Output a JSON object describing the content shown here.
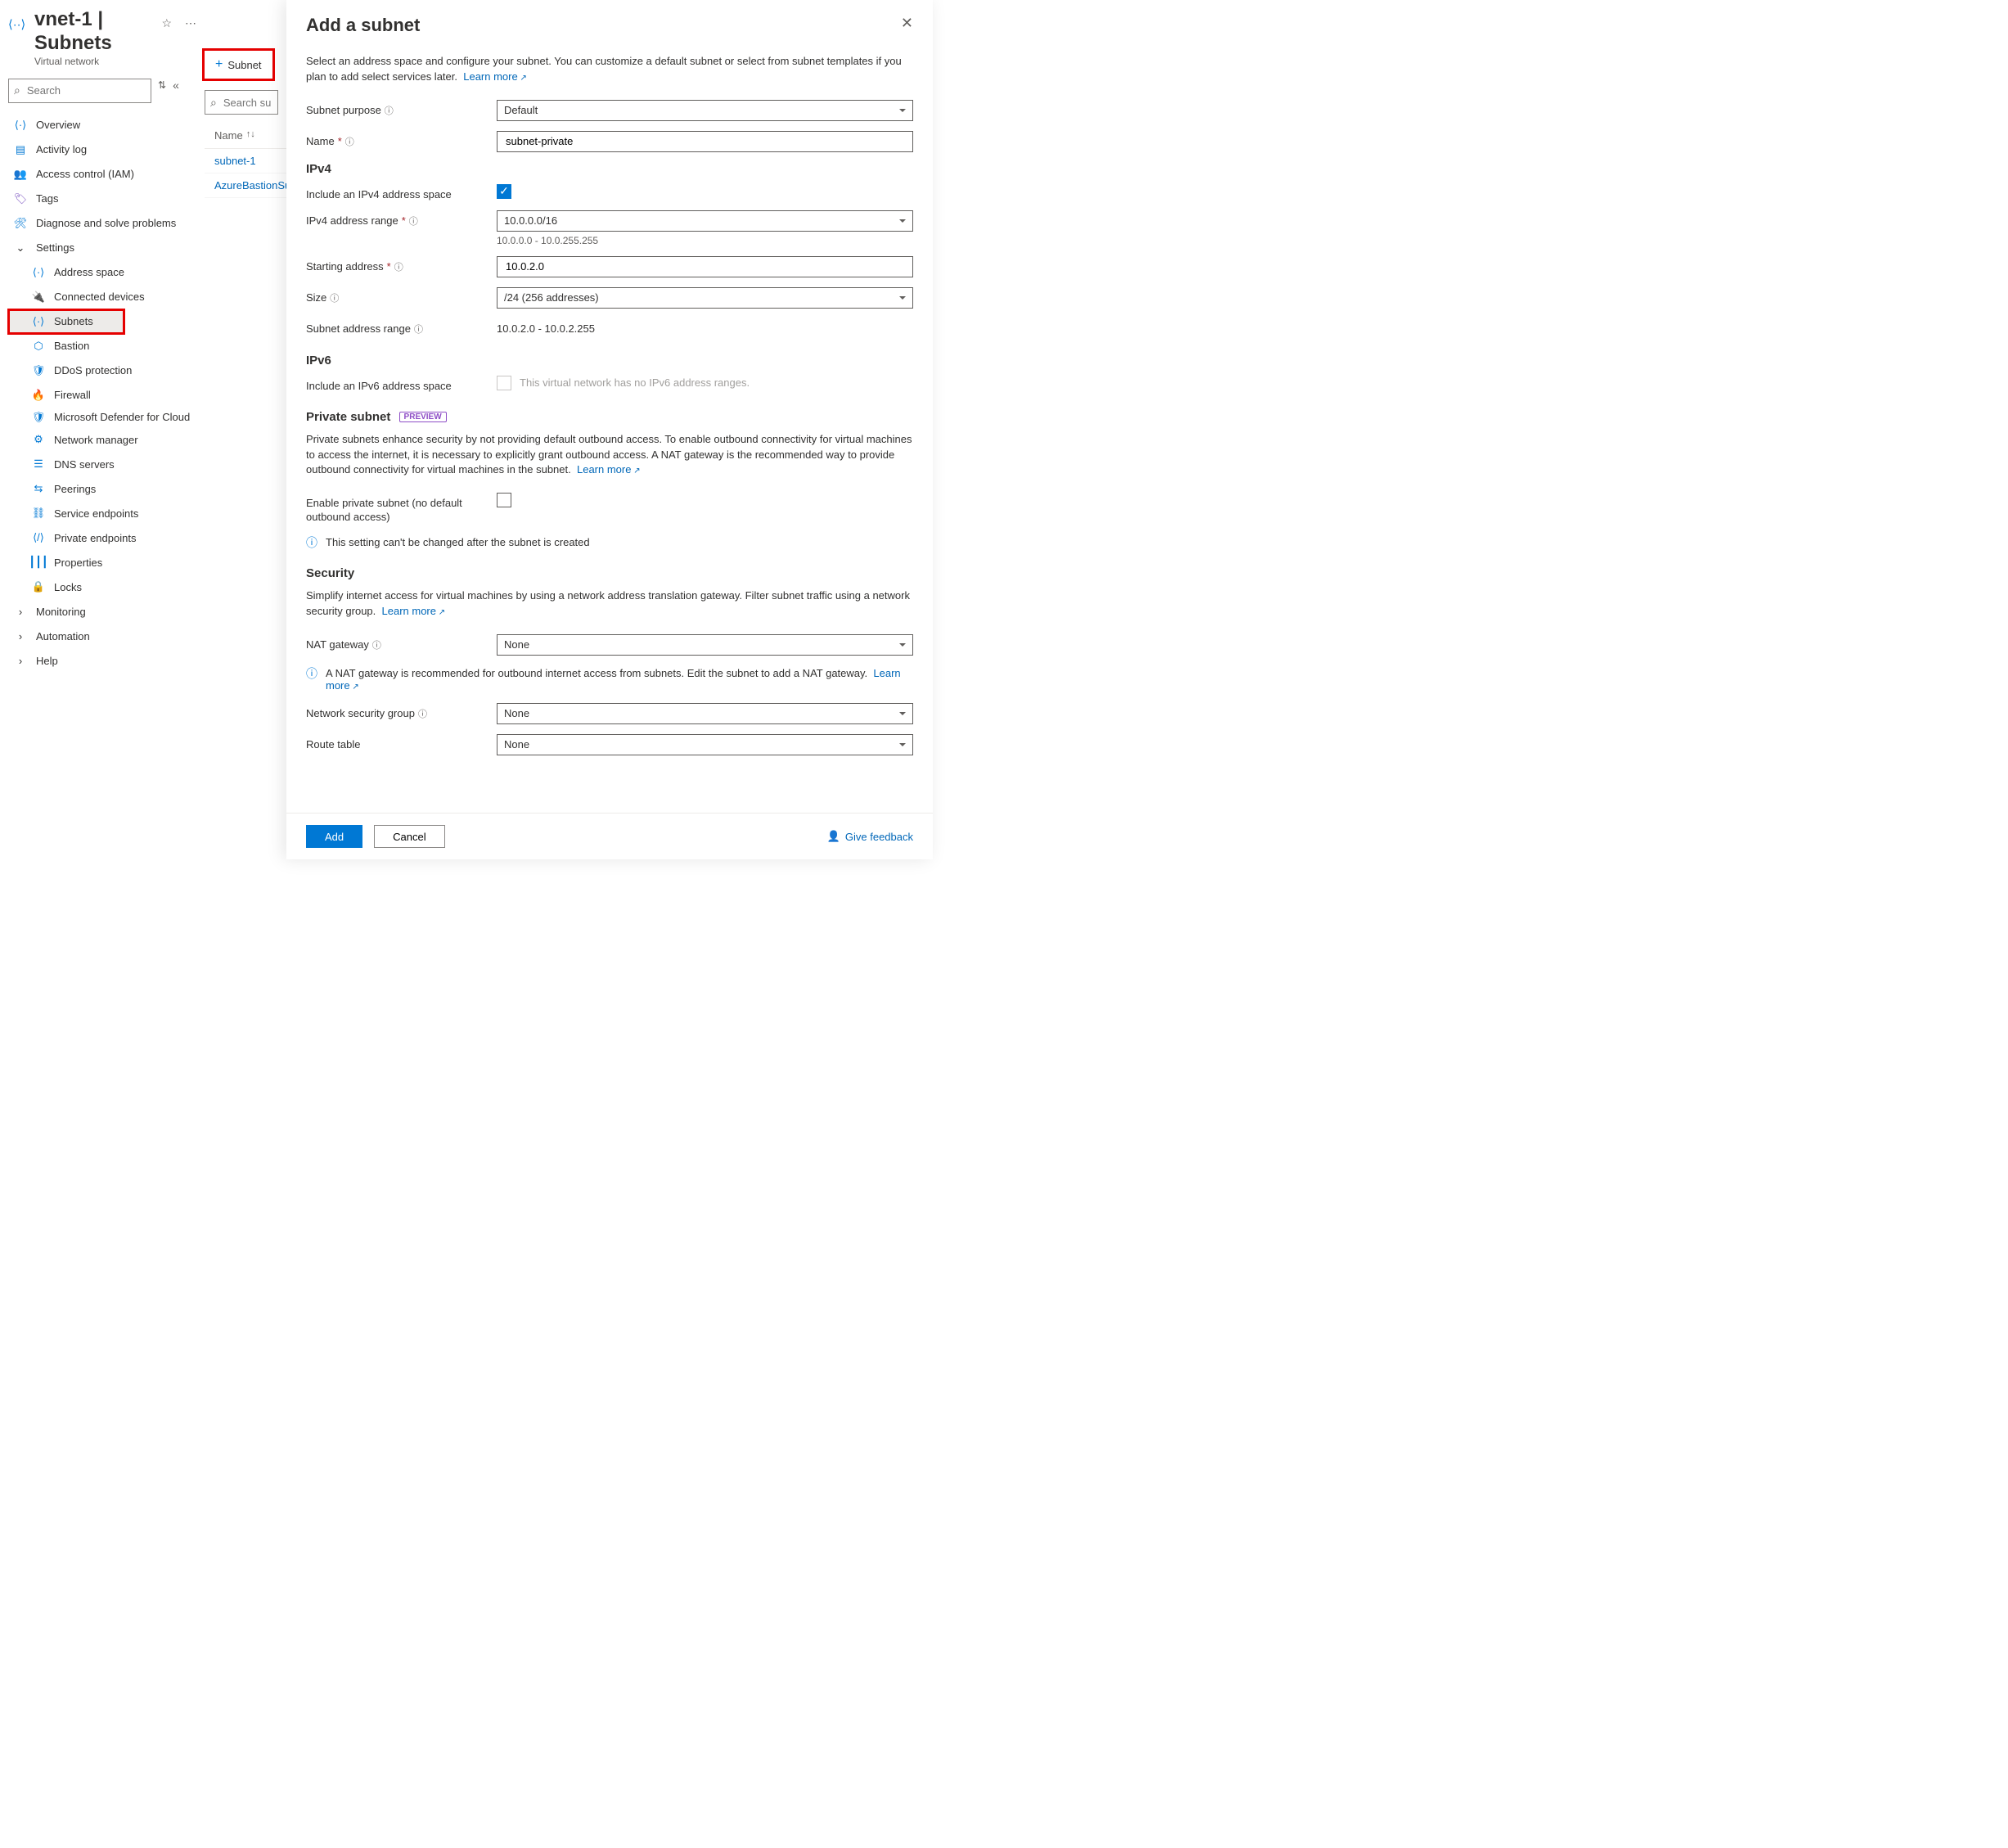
{
  "header": {
    "title": "vnet-1 | Subnets",
    "subtitle": "Virtual network"
  },
  "search": {
    "placeholder": "Search"
  },
  "nav": {
    "items": [
      {
        "label": "Overview"
      },
      {
        "label": "Activity log"
      },
      {
        "label": "Access control (IAM)"
      },
      {
        "label": "Tags"
      },
      {
        "label": "Diagnose and solve problems"
      }
    ],
    "settings_label": "Settings",
    "settings": [
      {
        "label": "Address space"
      },
      {
        "label": "Connected devices"
      },
      {
        "label": "Subnets"
      },
      {
        "label": "Bastion"
      },
      {
        "label": "DDoS protection"
      },
      {
        "label": "Firewall"
      },
      {
        "label": "Microsoft Defender for Cloud"
      },
      {
        "label": "Network manager"
      },
      {
        "label": "DNS servers"
      },
      {
        "label": "Peerings"
      },
      {
        "label": "Service endpoints"
      },
      {
        "label": "Private endpoints"
      },
      {
        "label": "Properties"
      },
      {
        "label": "Locks"
      }
    ],
    "expanders": [
      {
        "label": "Monitoring"
      },
      {
        "label": "Automation"
      },
      {
        "label": "Help"
      }
    ]
  },
  "mid": {
    "add_subnet_label": "Subnet",
    "search_placeholder": "Search subnets",
    "col_name": "Name",
    "rows": [
      "subnet-1",
      "AzureBastionSubnet"
    ]
  },
  "panel": {
    "title": "Add a subnet",
    "desc": "Select an address space and configure your subnet. You can customize a default subnet or select from subnet templates if you plan to add select services later.",
    "learn_more": "Learn more",
    "purpose_label": "Subnet purpose",
    "purpose_value": "Default",
    "name_label": "Name",
    "name_value": "subnet-private",
    "ipv4_heading": "IPv4",
    "ipv4_include_label": "Include an IPv4 address space",
    "ipv4_range_label": "IPv4 address range",
    "ipv4_range_value": "10.0.0.0/16",
    "ipv4_range_helper": "10.0.0.0 - 10.0.255.255",
    "start_label": "Starting address",
    "start_value": "10.0.2.0",
    "size_label": "Size",
    "size_value": "/24 (256 addresses)",
    "subnet_range_label": "Subnet address range",
    "subnet_range_value": "10.0.2.0 - 10.0.2.255",
    "ipv6_heading": "IPv6",
    "ipv6_include_label": "Include an IPv6 address space",
    "ipv6_disabled_msg": "This virtual network has no IPv6 address ranges.",
    "private_heading": "Private subnet",
    "private_badge": "PREVIEW",
    "private_desc": "Private subnets enhance security by not providing default outbound access. To enable outbound connectivity for virtual machines to access the internet, it is necessary to explicitly grant outbound access. A NAT gateway is the recommended way to provide outbound connectivity for virtual machines in the subnet.",
    "private_enable_label": "Enable private subnet (no default outbound access)",
    "private_info": "This setting can't be changed after the subnet is created",
    "security_heading": "Security",
    "security_desc": "Simplify internet access for virtual machines by using a network address translation gateway. Filter subnet traffic using a network security group.",
    "nat_label": "NAT gateway",
    "nat_value": "None",
    "nat_info": "A NAT gateway is recommended for outbound internet access from subnets. Edit the subnet to add a NAT gateway.",
    "nsg_label": "Network security group",
    "nsg_value": "None",
    "route_label": "Route table",
    "route_value": "None",
    "add_btn": "Add",
    "cancel_btn": "Cancel",
    "feedback": "Give feedback"
  }
}
